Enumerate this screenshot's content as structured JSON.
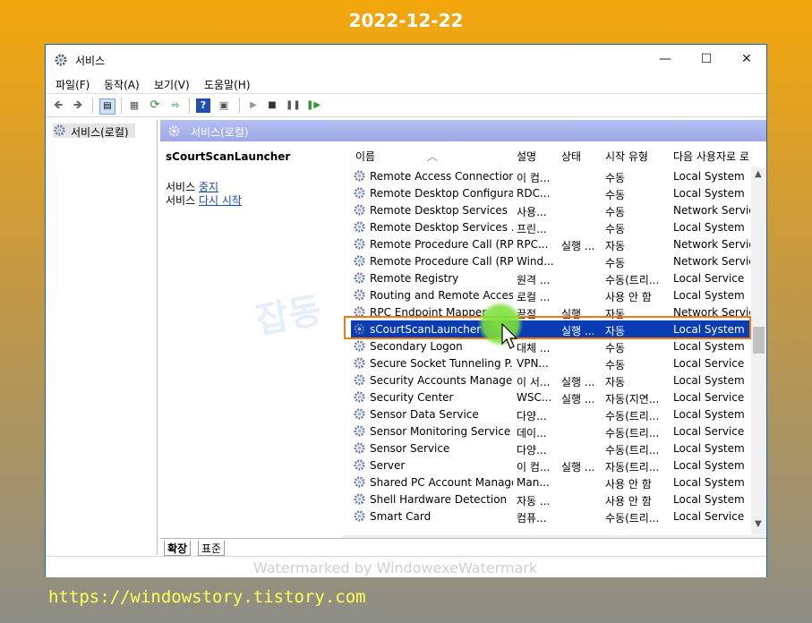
{
  "overlay": {
    "date": "2022-12-22",
    "url": "https://windowstory.tistory.com",
    "watermark": "Watermarked by WindowexeWatermark",
    "brand_faint": "잡동"
  },
  "window": {
    "title": "서비스",
    "controls": {
      "minimize": "—",
      "maximize": "☐",
      "close": "✕"
    }
  },
  "menu": [
    "파일(F)",
    "동작(A)",
    "보기(V)",
    "도움말(H)"
  ],
  "toolbar_icons": [
    "back-arrow-icon",
    "forward-arrow-icon",
    "show-tree-icon",
    "properties-icon",
    "refresh-icon",
    "export-icon",
    "help-icon",
    "console-icon",
    "start-icon",
    "stop-icon",
    "pause-icon",
    "resume-icon"
  ],
  "tree": {
    "root_label": "서비스(로컬)"
  },
  "pane_header": "서비스(로컬)",
  "detail": {
    "service_name": "sCourtScanLauncher",
    "line1_prefix": "서비스 ",
    "line1_link": "중지",
    "line2_prefix": "서비스 ",
    "line2_link": "다시 시작"
  },
  "columns": [
    "이름",
    "설명",
    "상태",
    "시작 유형",
    "다음 사용자로 로"
  ],
  "rows": [
    [
      "Remote Access Connection...",
      "이 컴...",
      "",
      "수동",
      "Local System"
    ],
    [
      "Remote Desktop Configura...",
      "RDC...",
      "",
      "수동",
      "Local System"
    ],
    [
      "Remote Desktop Services",
      "사용...",
      "",
      "수동",
      "Network Service"
    ],
    [
      "Remote Desktop Services ...",
      "프린...",
      "",
      "수동",
      "Local System"
    ],
    [
      "Remote Procedure Call (RP...",
      "RPC...",
      "실행 ...",
      "자동",
      "Network Service"
    ],
    [
      "Remote Procedure Call (RP...",
      "Wind...",
      "",
      "수동",
      "Network Service"
    ],
    [
      "Remote Registry",
      "원격 ...",
      "",
      "수동(트리...",
      "Local Service"
    ],
    [
      "Routing and Remote Access",
      "로컬 ...",
      "",
      "사용 안 함",
      "Local System"
    ],
    [
      "RPC Endpoint Mapper",
      "끝점...",
      "실행 ...",
      "자동",
      "Network Service"
    ],
    [
      "sCourtScanLauncher",
      "",
      "실행 ...",
      "자동",
      "Local System"
    ],
    [
      "Secondary Logon",
      "대체 ...",
      "",
      "수동",
      "Local System"
    ],
    [
      "Secure Socket Tunneling P...",
      "VPN...",
      "",
      "수동",
      "Local Service"
    ],
    [
      "Security Accounts Manager",
      "이 서...",
      "실행 ...",
      "자동",
      "Local System"
    ],
    [
      "Security Center",
      "WSC...",
      "실행 ...",
      "자동(지연...",
      "Local Service"
    ],
    [
      "Sensor Data Service",
      "다양...",
      "",
      "수동(트리...",
      "Local System"
    ],
    [
      "Sensor Monitoring Service",
      "데이...",
      "",
      "수동(트리...",
      "Local Service"
    ],
    [
      "Sensor Service",
      "다양...",
      "",
      "수동(트리...",
      "Local System"
    ],
    [
      "Server",
      "이 컴...",
      "실행 ...",
      "자동(트리...",
      "Local System"
    ],
    [
      "Shared PC Account Manager",
      "Man...",
      "",
      "사용 안 함",
      "Local System"
    ],
    [
      "Shell Hardware Detection",
      "자동 ...",
      "",
      "사용 안 함",
      "Local System"
    ],
    [
      "Smart Card",
      "컴퓨...",
      "",
      "수동(트리...",
      "Local Service"
    ]
  ],
  "selected_index": 9,
  "tabs": [
    "확장",
    "표준"
  ],
  "colors": {
    "selection": "#0a3cb4",
    "highlight_box": "#f07a14",
    "pane_header": "#9ea8e4",
    "link": "#1a4db5"
  }
}
